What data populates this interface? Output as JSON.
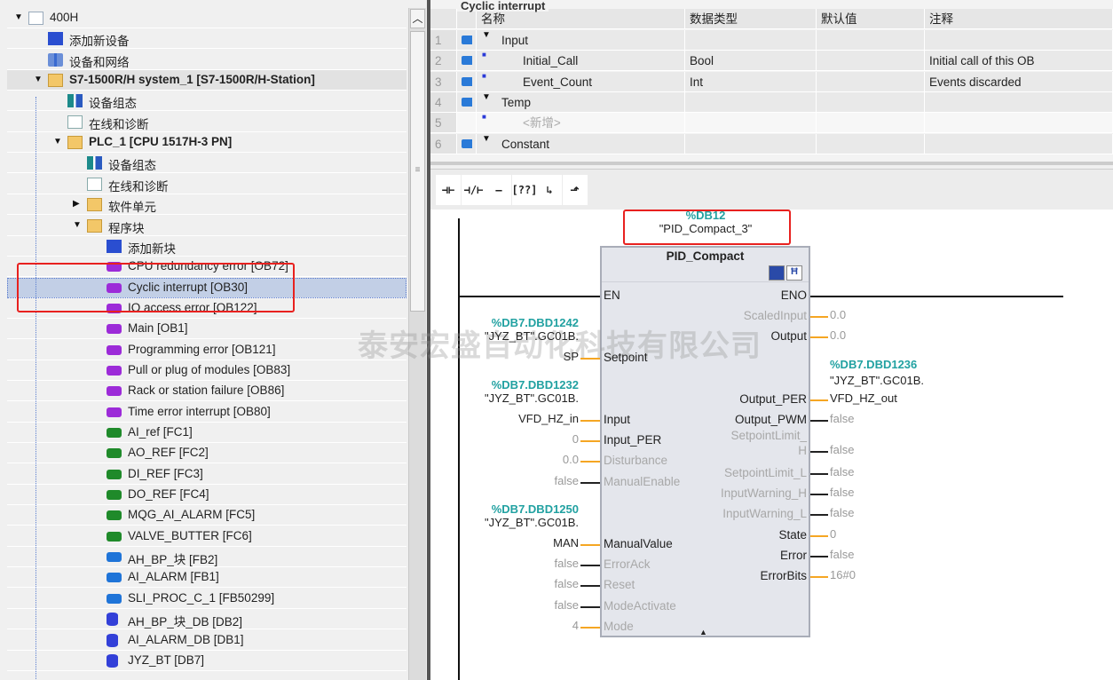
{
  "tree": {
    "items": [
      {
        "label": "400H",
        "depth": 0,
        "icon": "project-icon",
        "expand": "open"
      },
      {
        "label": "添加新设备",
        "depth": 1,
        "icon": "add-device-icon"
      },
      {
        "label": "设备和网络",
        "depth": 1,
        "icon": "network-icon"
      },
      {
        "label": "S7-1500R/H system_1 [S7-1500R/H-Station]",
        "depth": 1,
        "icon": "station-folder-icon",
        "expand": "open",
        "bold": true
      },
      {
        "label": "设备组态",
        "depth": 2,
        "icon": "device-config-icon"
      },
      {
        "label": "在线和诊断",
        "depth": 2,
        "icon": "online-diagnostics-icon"
      },
      {
        "label": "PLC_1 [CPU 1517H-3 PN]",
        "depth": 2,
        "icon": "plc-folder-icon",
        "expand": "open",
        "bold": true
      },
      {
        "label": "设备组态",
        "depth": 3,
        "icon": "device-config-icon"
      },
      {
        "label": "在线和诊断",
        "depth": 3,
        "icon": "online-diagnostics-icon"
      },
      {
        "label": "软件单元",
        "depth": 3,
        "icon": "software-units-icon",
        "expand": "closed"
      },
      {
        "label": "程序块",
        "depth": 3,
        "icon": "program-blocks-icon",
        "expand": "open"
      },
      {
        "label": "添加新块",
        "depth": 4,
        "icon": "add-block-icon"
      },
      {
        "label": "CPU redundancy error [OB72]",
        "depth": 4,
        "icon": "ob-icon"
      },
      {
        "label": "Cyclic interrupt [OB30]",
        "depth": 4,
        "icon": "ob-icon",
        "selected": true
      },
      {
        "label": "IO access error [OB122]",
        "depth": 4,
        "icon": "ob-icon"
      },
      {
        "label": "Main [OB1]",
        "depth": 4,
        "icon": "ob-icon"
      },
      {
        "label": "Programming error [OB121]",
        "depth": 4,
        "icon": "ob-icon"
      },
      {
        "label": "Pull or plug of modules [OB83]",
        "depth": 4,
        "icon": "ob-icon"
      },
      {
        "label": "Rack or station failure [OB86]",
        "depth": 4,
        "icon": "ob-icon"
      },
      {
        "label": "Time error interrupt [OB80]",
        "depth": 4,
        "icon": "ob-icon"
      },
      {
        "label": "AI_ref [FC1]",
        "depth": 4,
        "icon": "fc-icon"
      },
      {
        "label": "AO_REF [FC2]",
        "depth": 4,
        "icon": "fc-icon"
      },
      {
        "label": "DI_REF [FC3]",
        "depth": 4,
        "icon": "fc-icon"
      },
      {
        "label": "DO_REF [FC4]",
        "depth": 4,
        "icon": "fc-icon"
      },
      {
        "label": "MQG_AI_ALARM [FC5]",
        "depth": 4,
        "icon": "fc-icon"
      },
      {
        "label": "VALVE_BUTTER [FC6]",
        "depth": 4,
        "icon": "fc-icon"
      },
      {
        "label": "AH_BP_块 [FB2]",
        "depth": 4,
        "icon": "fb-icon"
      },
      {
        "label": "AI_ALARM [FB1]",
        "depth": 4,
        "icon": "fb-icon"
      },
      {
        "label": "SLI_PROC_C_1 [FB50299]",
        "depth": 4,
        "icon": "fb-icon"
      },
      {
        "label": "AH_BP_块_DB [DB2]",
        "depth": 4,
        "icon": "db-icon"
      },
      {
        "label": "AI_ALARM_DB [DB1]",
        "depth": 4,
        "icon": "db-icon"
      },
      {
        "label": "JYZ_BT [DB7]",
        "depth": 4,
        "icon": "db-icon"
      }
    ]
  },
  "interface": {
    "title": "Cyclic interrupt",
    "columns": [
      "名称",
      "数据类型",
      "默认值",
      "注释"
    ],
    "rows": [
      {
        "num": "1",
        "name": "Input",
        "type": "",
        "default": "",
        "comment": "",
        "section": true
      },
      {
        "num": "2",
        "name": "Initial_Call",
        "type": "Bool",
        "default": "",
        "comment": "Initial call of this OB"
      },
      {
        "num": "3",
        "name": "Event_Count",
        "type": "Int",
        "default": "",
        "comment": "Events discarded"
      },
      {
        "num": "4",
        "name": "Temp",
        "type": "",
        "default": "",
        "comment": "",
        "section": true
      },
      {
        "num": "5",
        "name": "<新增>",
        "type": "",
        "default": "",
        "comment": "",
        "placeholder": true
      },
      {
        "num": "6",
        "name": "Constant",
        "type": "",
        "default": "",
        "comment": "",
        "section": true
      }
    ]
  },
  "toolbar": {
    "buttons": [
      {
        "name": "normally-open-contact",
        "glyph": "⊣⊢"
      },
      {
        "name": "normally-closed-contact",
        "glyph": "⊣/⊢"
      },
      {
        "name": "coil",
        "glyph": "–()–"
      },
      {
        "name": "empty-box",
        "glyph": "[??]"
      },
      {
        "name": "open-branch",
        "glyph": "↳"
      },
      {
        "name": "close-branch",
        "glyph": "⬏"
      }
    ]
  },
  "block": {
    "instance_address": "%DB12",
    "instance_name": "\"PID_Compact_3\"",
    "type": "PID_Compact",
    "inputs": [
      {
        "pin": "EN",
        "value": "",
        "wire": "power"
      },
      {
        "pin": "Setpoint",
        "addr": "%DB7.DBD1242",
        "value": "\"JYZ_BT\".GC01B.",
        "value2": "SP",
        "wire": "orange"
      },
      {
        "pin": "Input",
        "addr": "%DB7.DBD1232",
        "value": "\"JYZ_BT\".GC01B.",
        "value2": "VFD_HZ_in",
        "wire": "orange"
      },
      {
        "pin": "Input_PER",
        "value2": "0",
        "wire": "orange",
        "grey": true
      },
      {
        "pin": "Disturbance",
        "value2": "0.0",
        "wire": "orange",
        "grey": true,
        "dim": true
      },
      {
        "pin": "ManualEnable",
        "value2": "false",
        "wire": "black",
        "grey": true,
        "dim": true
      },
      {
        "pin": "ManualValue",
        "addr": "%DB7.DBD1250",
        "value": "\"JYZ_BT\".GC01B.",
        "value2": "MAN",
        "wire": "orange"
      },
      {
        "pin": "ErrorAck",
        "value2": "false",
        "wire": "black",
        "grey": true,
        "dim": true
      },
      {
        "pin": "Reset",
        "value2": "false",
        "wire": "black",
        "grey": true,
        "dim": true
      },
      {
        "pin": "ModeActivate",
        "value2": "false",
        "wire": "black",
        "grey": true,
        "dim": true
      },
      {
        "pin": "Mode",
        "value2": "4",
        "wire": "orange",
        "grey": true,
        "dim": true
      }
    ],
    "outputs": [
      {
        "pin": "ENO",
        "value": "",
        "wire": "power"
      },
      {
        "pin": "ScaledInput",
        "value": "0.0",
        "wire": "orange",
        "dim": true
      },
      {
        "pin": "Output",
        "value": "0.0",
        "wire": "orange"
      },
      {
        "pin": "Output_PER",
        "addr": "%DB7.DBD1236",
        "value0": "\"JYZ_BT\".GC01B.",
        "value": "VFD_HZ_out",
        "wire": "orange",
        "dark": true
      },
      {
        "pin": "Output_PWM",
        "value": "false",
        "wire": "black"
      },
      {
        "pin": "SetpointLimit_",
        "pin2": "H",
        "value": "false",
        "wire": "black",
        "dim": true
      },
      {
        "pin": "SetpointLimit_L",
        "value": "false",
        "wire": "black",
        "dim": true
      },
      {
        "pin": "InputWarning_H",
        "value": "false",
        "wire": "black",
        "dim": true
      },
      {
        "pin": "InputWarning_L",
        "value": "false",
        "wire": "black",
        "dim": true
      },
      {
        "pin": "State",
        "value": "0",
        "wire": "orange"
      },
      {
        "pin": "Error",
        "value": "false",
        "wire": "black"
      },
      {
        "pin": "ErrorBits",
        "value": "16#0",
        "wire": "orange"
      }
    ]
  },
  "watermark": "泰安宏盛自动化科技有限公司",
  "colors": {
    "accent_teal": "#21a1a1",
    "wire_orange": "#f5a623",
    "highlight_red": "#e8211f",
    "selection": "#c2cfe6"
  }
}
